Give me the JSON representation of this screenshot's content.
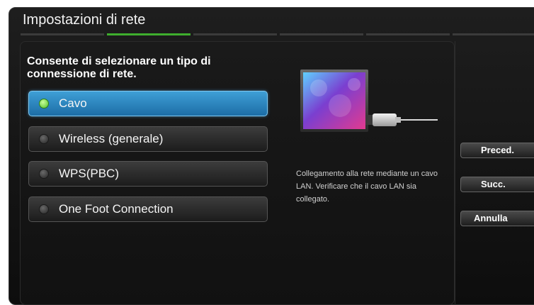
{
  "window": {
    "title": "Impostazioni di rete"
  },
  "steps": {
    "total": 6,
    "active_index": 1
  },
  "prompt": "Consente di selezionare un tipo di connessione di rete.",
  "options": [
    {
      "label": "Cavo",
      "selected": true
    },
    {
      "label": "Wireless (generale)",
      "selected": false
    },
    {
      "label": "WPS(PBC)",
      "selected": false
    },
    {
      "label": "One Foot Connection",
      "selected": false
    }
  ],
  "description": "Collegamento alla rete mediante un cavo LAN. Verificare che il cavo LAN sia collegato.",
  "side_buttons": {
    "prev": "Preced.",
    "next": "Succ.",
    "cancel": "Annulla"
  },
  "colors": {
    "accent_green": "#3eae2d",
    "selected_blue": "#2f86c0"
  }
}
